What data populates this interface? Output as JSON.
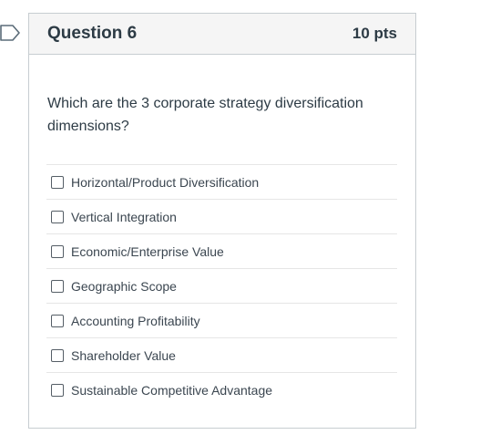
{
  "question": {
    "title": "Question 6",
    "points": "10 pts",
    "text": "Which are the 3 corporate strategy diversification dimensions?",
    "flag_icon": "bookmark-flag-outline-icon"
  },
  "answers": [
    {
      "label": "Horizontal/Product Diversification",
      "checked": false
    },
    {
      "label": "Vertical Integration",
      "checked": false
    },
    {
      "label": "Economic/Enterprise Value",
      "checked": false
    },
    {
      "label": "Geographic Scope",
      "checked": false
    },
    {
      "label": "Accounting Profitability",
      "checked": false
    },
    {
      "label": "Shareholder Value",
      "checked": false
    },
    {
      "label": "Sustainable Competitive Advantage",
      "checked": false
    }
  ]
}
